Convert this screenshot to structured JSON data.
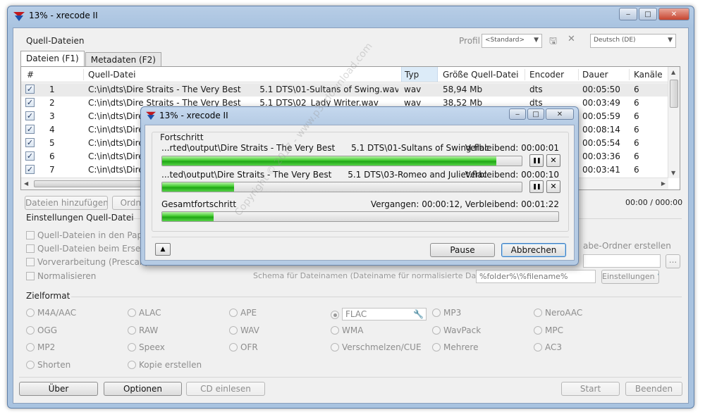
{
  "window": {
    "title": "13% - xrecode II",
    "caption": {
      "minimize": "‒",
      "maximize": "□",
      "close": "✕"
    }
  },
  "source": {
    "group_label": "Quell-Dateien",
    "profile_label": "Profil",
    "profile_value": "<Standard>",
    "language_value": "Deutsch (DE)",
    "tabs": [
      {
        "label": "Dateien (F1)",
        "active": true
      },
      {
        "label": "Metadaten (F2)",
        "active": false
      }
    ],
    "columns": {
      "num": "#",
      "file": "Quell-Datei",
      "type": "Typ",
      "size": "Größe Quell-Datei",
      "encoder": "Encoder",
      "duration": "Dauer",
      "channels": "Kanäle"
    },
    "rows": [
      {
        "num": "1",
        "file": "C:\\in\\dts\\Dire Straits - The Very Best       5.1 DTS\\01-Sultans of Swing.wav",
        "type": "wav",
        "size": "58,94 Mb",
        "encoder": "dts",
        "duration": "00:05:50",
        "channels": "6",
        "selected": true
      },
      {
        "num": "2",
        "file": "C:\\in\\dts\\Dire Straits - The Very Best       5.1 DTS\\02_Lady Writer.wav",
        "type": "wav",
        "size": "38,52 Mb",
        "encoder": "dts",
        "duration": "00:03:49",
        "channels": "6",
        "selected": false
      },
      {
        "num": "3",
        "file": "C:\\in\\dts\\Dire S",
        "type": "",
        "size": "",
        "encoder": "",
        "duration": "00:05:59",
        "channels": "6",
        "selected": false
      },
      {
        "num": "4",
        "file": "C:\\in\\dts\\Dire S",
        "type": "",
        "size": "",
        "encoder": "",
        "duration": "00:08:14",
        "channels": "6",
        "selected": false
      },
      {
        "num": "5",
        "file": "C:\\in\\dts\\Dire S",
        "type": "",
        "size": "",
        "encoder": "",
        "duration": "00:05:54",
        "channels": "6",
        "selected": false
      },
      {
        "num": "6",
        "file": "C:\\in\\dts\\Dire S",
        "type": "",
        "size": "",
        "encoder": "",
        "duration": "00:03:36",
        "channels": "6",
        "selected": false
      },
      {
        "num": "7",
        "file": "C:\\in\\dts\\Dire S",
        "type": "",
        "size": "",
        "encoder": "",
        "duration": "00:03:41",
        "channels": "6",
        "selected": false
      }
    ],
    "add_files_button": "Dateien hinzufügen",
    "add_folder_button": "Ordne",
    "total_time": "00:00 / 000:00"
  },
  "settings": {
    "group_label": "Einstellungen Quell-Datei",
    "options": [
      "Quell-Dateien in den Papierko",
      "Quell-Dateien beim Ersetzen u",
      "Vorverarbeitung (Prescan)",
      "Normalisieren"
    ],
    "output_folder_label": "abe-Ordner erstellen",
    "schema_label": "Schema für Dateinamen (Dateiname für normalisierte Dateien)",
    "schema_value": "%folder%\\%filename%",
    "settings_button": "Einstellungen",
    "browse_button": "..."
  },
  "target": {
    "group_label": "Zielformat",
    "formats": [
      [
        "M4A/AAC",
        "ALAC",
        "APE",
        "FLAC",
        "MP3",
        "NeroAAC"
      ],
      [
        "OGG",
        "RAW",
        "WAV",
        "WMA",
        "WavPack",
        "MPC"
      ],
      [
        "MP2",
        "Speex",
        "OFR",
        "Verschmelzen/CUE",
        "Mehrere",
        "AC3"
      ],
      [
        "Shorten",
        "Kopie erstellen"
      ]
    ],
    "selected": "FLAC"
  },
  "bottom": {
    "about_button": "Über",
    "options_button": "Optionen",
    "cd_button": "CD einlesen",
    "start_button": "Start",
    "exit_button": "Beenden"
  },
  "dialog": {
    "title": "13% - xrecode II",
    "group_label": "Fortschritt",
    "jobs": [
      {
        "file": "...rted\\output\\Dire Straits - The Very Best      5.1 DTS\\01-Sultans of Swing.flac",
        "remaining": "Verbleibend: 00:00:01",
        "progress": 0.93
      },
      {
        "file": "...ted\\output\\Dire Straits - The Very Best      5.1 DTS\\03-Romeo and Juliet.flac",
        "remaining": "Verbleibend: 00:00:10",
        "progress": 0.2
      }
    ],
    "total_label": "Gesamtfortschritt",
    "total_times": "Vergangen: 00:00:12, Verbleibend: 00:01:22",
    "total_progress": 0.13,
    "pause_icon": "❚❚",
    "stop_icon": "✕",
    "collapse_icon": "▲",
    "pause_button": "Pause",
    "cancel_button": "Abbrechen"
  },
  "watermark": "Copyright © 2017 - www.p30download.com",
  "colors": {
    "progress_green": "#3dc92b",
    "title_bar": "#b7cde6"
  }
}
